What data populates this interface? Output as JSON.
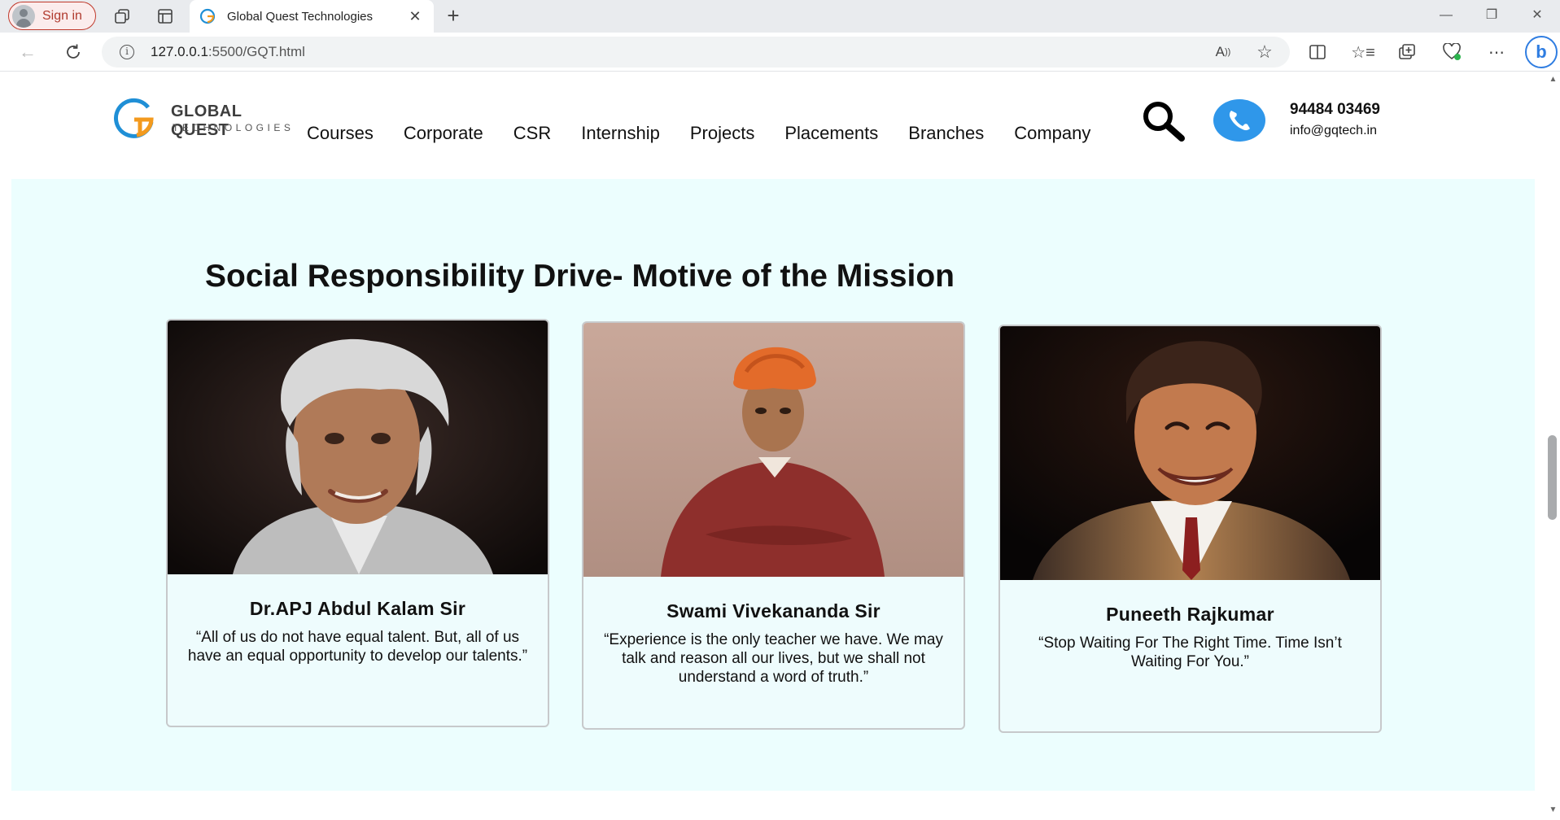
{
  "browser": {
    "signin_label": "Sign in",
    "tab_title": "Global Quest Technologies",
    "url_host": "127.0.0.1",
    "url_path": ":5500/GQT.html"
  },
  "header": {
    "logo_line1": "GLOBAL QUEST",
    "logo_line2": "TECHNOLOGIES",
    "nav": [
      "Courses",
      "Corporate",
      "CSR",
      "Internship",
      "Projects",
      "Placements",
      "Branches",
      "Company"
    ],
    "phone": "94484 03469",
    "email": "info@gqtech.in"
  },
  "section": {
    "title": "Social Responsibility Drive- Motive of the Mission",
    "background": "#ecfefe"
  },
  "cards": [
    {
      "name": "Dr.APJ Abdul Kalam Sir",
      "quote": "“All of us do not have equal talent. But, all of us have an equal opportunity to develop our talents.”"
    },
    {
      "name": "Swami Vivekananda Sir",
      "quote": "“Experience is the only teacher we have. We may talk and reason all our lives, but we shall not understand a word of truth.”"
    },
    {
      "name": "Puneeth Rajkumar",
      "quote": "“Stop Waiting For The Right Time. Time Isn’t Waiting For You.”"
    }
  ],
  "colors": {
    "accent_blue": "#2f97ea",
    "logo_orange": "#f39a1e",
    "logo_blue": "#1f8fd6"
  }
}
